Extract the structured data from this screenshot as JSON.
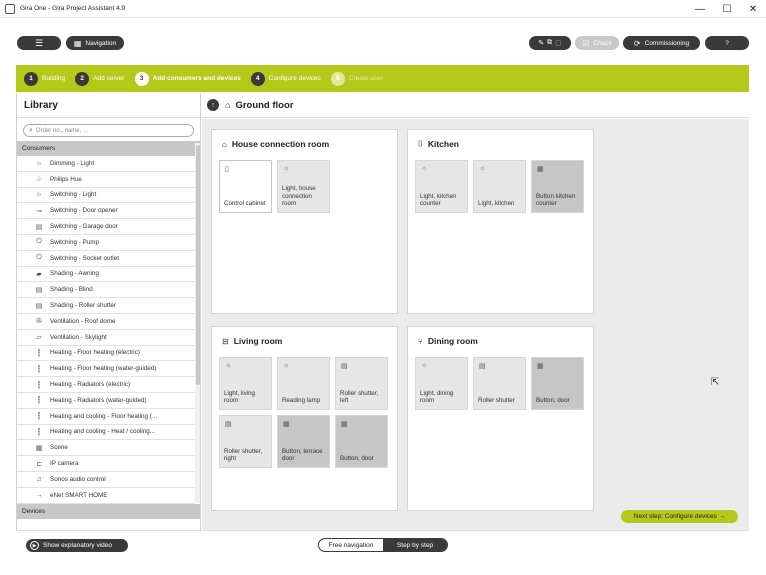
{
  "window": {
    "title": "Gira One - Gira Project Assistant 4.9",
    "minimize": "—",
    "maximize": "☐",
    "close": "✕"
  },
  "toolbar": {
    "menu_icon": "menu-icon",
    "navigation_label": "Navigation",
    "check_label": "Check",
    "commissioning_label": "Commissioning",
    "help_label": "?"
  },
  "steps": [
    {
      "num": "1",
      "label": "Building",
      "state": "done"
    },
    {
      "num": "2",
      "label": "Add server",
      "state": "done"
    },
    {
      "num": "3",
      "label": "Add consumers and devices",
      "state": "active"
    },
    {
      "num": "4",
      "label": "Configure devices",
      "state": "done"
    },
    {
      "num": "5",
      "label": "Create user",
      "state": "future"
    }
  ],
  "library": {
    "title": "Library",
    "search_placeholder": "Order no., name, ...",
    "consumers_label": "Consumers",
    "devices_label": "Devices",
    "items": [
      {
        "icon": "light-icon",
        "label": "Dimming - Light"
      },
      {
        "icon": "hue-icon",
        "label": "Philips Hue"
      },
      {
        "icon": "light-icon",
        "label": "Switching - Light"
      },
      {
        "icon": "key-icon",
        "label": "Switching - Door opener"
      },
      {
        "icon": "garage-icon",
        "label": "Switching - Garage door"
      },
      {
        "icon": "pump-icon",
        "label": "Switching - Pump"
      },
      {
        "icon": "socket-icon",
        "label": "Switching - Socket outlet"
      },
      {
        "icon": "awning-icon",
        "label": "Shading - Awning"
      },
      {
        "icon": "blind-icon",
        "label": "Shading - Blind"
      },
      {
        "icon": "shutter-icon",
        "label": "Shading - Roller shutter"
      },
      {
        "icon": "fan-icon",
        "label": "Ventilation - Roof dome"
      },
      {
        "icon": "skylight-icon",
        "label": "Ventilation - Skylight"
      },
      {
        "icon": "heating-icon",
        "label": "Heating - Floor heating (electric)"
      },
      {
        "icon": "heating-icon",
        "label": "Heating - Floor heating (water-guided)"
      },
      {
        "icon": "heating-icon",
        "label": "Heating - Radiators (electric)"
      },
      {
        "icon": "heating-icon",
        "label": "Heating - Radiators (water-guided)"
      },
      {
        "icon": "heating-icon",
        "label": "Heating and cooling - Floor heating (..."
      },
      {
        "icon": "heating-icon",
        "label": "Heating and cooling - Heat / cooling..."
      },
      {
        "icon": "scene-icon",
        "label": "Scene"
      },
      {
        "icon": "camera-icon",
        "label": "IP camera"
      },
      {
        "icon": "music-icon",
        "label": "Sonos audio control"
      },
      {
        "icon": "arrow-icon",
        "label": "eNet SMART HOME"
      }
    ]
  },
  "main": {
    "floor_title": "Ground floor",
    "next_step_label": "Next step: Configure devices →",
    "rooms": [
      {
        "name": "House connection room",
        "icon": "house-icon",
        "tiles": [
          {
            "icon": "cabinet-icon",
            "label": "Control cabinet",
            "style": "white"
          },
          {
            "icon": "light-icon",
            "label": "Light, house connection room",
            "style": "light"
          }
        ]
      },
      {
        "name": "Kitchen",
        "icon": "kitchen-icon",
        "tiles": [
          {
            "icon": "light-icon",
            "label": "Light, kitchen counter",
            "style": "light"
          },
          {
            "icon": "light-icon",
            "label": "Light, kitchen",
            "style": "light"
          },
          {
            "icon": "button-icon",
            "label": "Button kitchen counter",
            "style": "dark"
          }
        ]
      },
      {
        "name": "Living room",
        "icon": "sofa-icon",
        "tiles": [
          {
            "icon": "light-icon",
            "label": "Light, living room",
            "style": "light"
          },
          {
            "icon": "light-icon",
            "label": "Reading lamp",
            "style": "light"
          },
          {
            "icon": "shutter-icon",
            "label": "Roller shutter, left",
            "style": "light"
          },
          {
            "icon": "shutter-icon",
            "label": "Roller shutter, right",
            "style": "light"
          },
          {
            "icon": "button-icon",
            "label": "Button, terrace door",
            "style": "dark"
          },
          {
            "icon": "button-icon",
            "label": "Button, door",
            "style": "dark"
          }
        ]
      },
      {
        "name": "Dining room",
        "icon": "cutlery-icon",
        "tiles": [
          {
            "icon": "light-icon",
            "label": "Light, dining room",
            "style": "light"
          },
          {
            "icon": "shutter-icon",
            "label": "Roller shutter",
            "style": "light"
          },
          {
            "icon": "button-icon",
            "label": "Button, door",
            "style": "dark"
          }
        ]
      }
    ]
  },
  "bottom": {
    "video_label": "Show explanatory video",
    "mode_free": "Free navigation",
    "mode_step": "Step by step"
  },
  "colors": {
    "accent": "#b5c91a",
    "dark": "#3a3a3a"
  }
}
